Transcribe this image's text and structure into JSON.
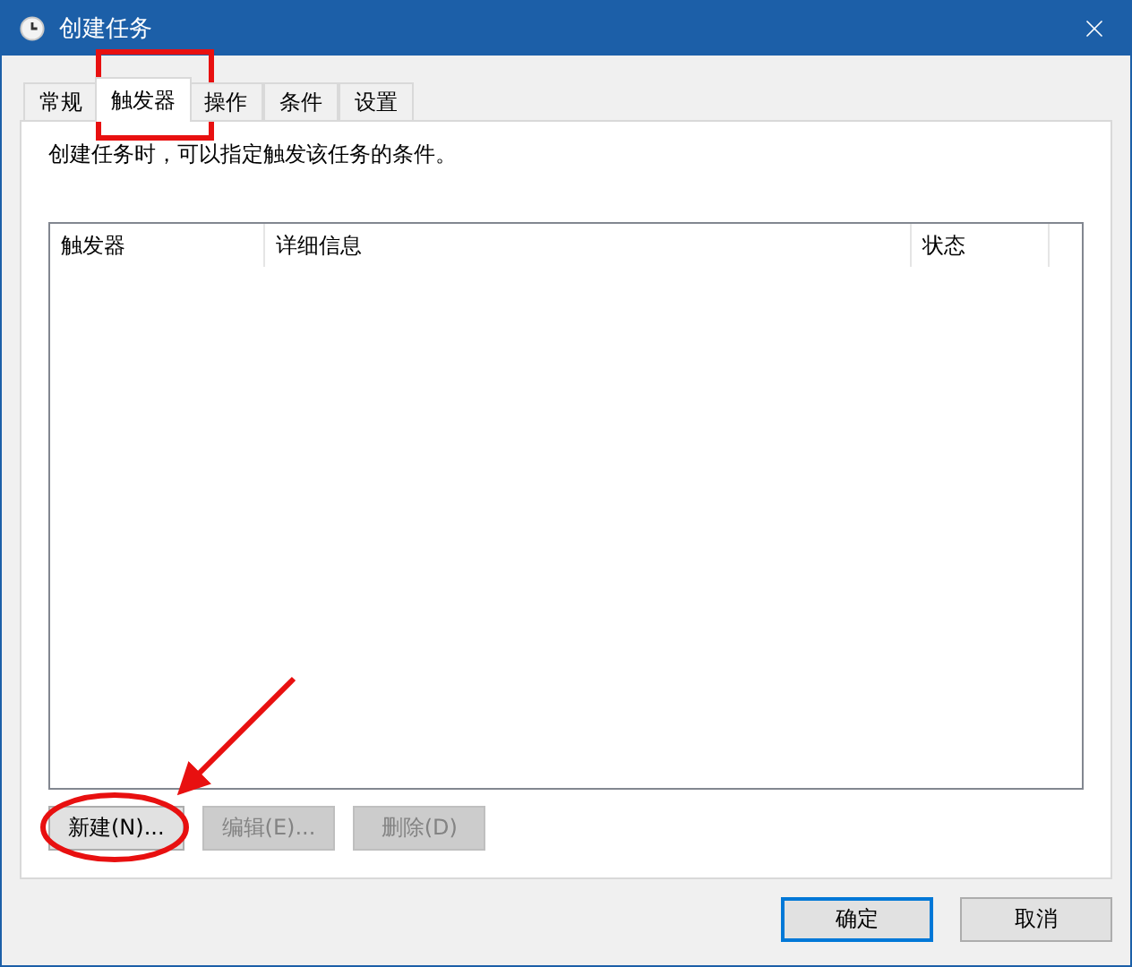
{
  "window": {
    "title": "创建任务"
  },
  "tabs": [
    {
      "label": "常规",
      "selected": false
    },
    {
      "label": "触发器",
      "selected": true
    },
    {
      "label": "操作",
      "selected": false
    },
    {
      "label": "条件",
      "selected": false
    },
    {
      "label": "设置",
      "selected": false
    }
  ],
  "description": "创建任务时，可以指定触发该任务的条件。",
  "table": {
    "columns": [
      "触发器",
      "详细信息",
      "状态"
    ]
  },
  "list_buttons": [
    {
      "label": "新建(N)...",
      "disabled": false
    },
    {
      "label": "编辑(E)...",
      "disabled": true
    },
    {
      "label": "删除(D)",
      "disabled": true
    }
  ],
  "footer_buttons": [
    {
      "label": "确定",
      "default": true
    },
    {
      "label": "取消",
      "default": false
    }
  ]
}
